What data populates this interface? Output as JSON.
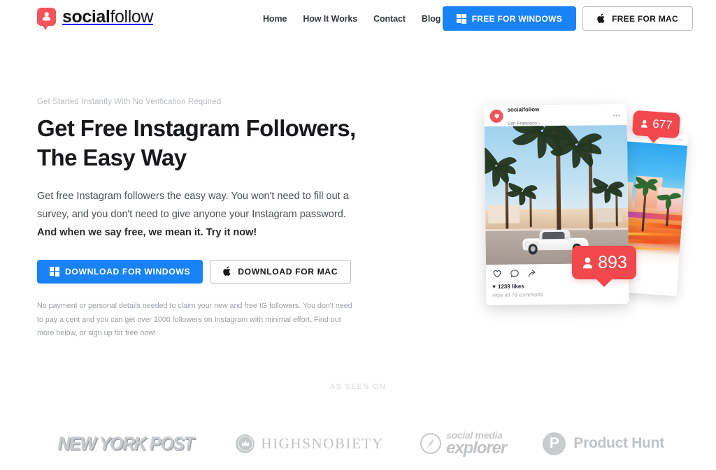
{
  "brand": {
    "name_bold": "social",
    "name_light": "follow",
    "logo_icon": "person-speech-bubble-icon",
    "accent_red": "#f2555a",
    "accent_blue": "#1a82f7"
  },
  "header": {
    "nav": [
      {
        "label": "Home"
      },
      {
        "label": "How It Works"
      },
      {
        "label": "Contact"
      },
      {
        "label": "Blog"
      }
    ],
    "buttons": [
      {
        "label": "FREE FOR WINDOWS",
        "icon": "windows-icon",
        "style": "blue"
      },
      {
        "label": "FREE FOR MAC",
        "icon": "apple-icon",
        "style": "white"
      }
    ]
  },
  "hero": {
    "eyebrow": "Get Started Instantly With No Verification Required",
    "headline_line1": "Get Free Instagram Followers,",
    "headline_line2": "The Easy Way",
    "lede_normal": "Get free Instagram followers the easy way. You won't need to fill out a survey, and you don't need to give anyone your Instagram password. ",
    "lede_bold": "And when we say free, we mean it. Try it now!",
    "cta": [
      {
        "label": "DOWNLOAD FOR WINDOWS",
        "icon": "windows-icon",
        "style": "blue"
      },
      {
        "label": "DOWNLOAD FOR MAC",
        "icon": "apple-icon",
        "style": "white"
      }
    ],
    "fineprint": "No payment or personal details needed to claim your new and free IG followers. You don't need to pay a cent and you can get over 1000 followers on Instagram with minimal effort. Find out more below, or sign up for free now!"
  },
  "instagram_mock": {
    "username": "socialfollow",
    "location": "San Francisco ›",
    "more_dots": "•••",
    "likes": "1239 likes",
    "comments": "view all 78 comments",
    "badges": [
      {
        "count": "677",
        "icon": "person-icon"
      },
      {
        "count": "893",
        "icon": "person-icon"
      }
    ],
    "actions": [
      "heart-icon",
      "comment-icon",
      "share-icon"
    ]
  },
  "press": {
    "heading": "AS SEEN ON",
    "logos": [
      {
        "name": "New York Post",
        "text": "NEW YORK POST"
      },
      {
        "name": "Highsnobiety",
        "text": "HIGHSNOBIETY",
        "icon": "crown-badge-icon"
      },
      {
        "name": "Social Media Explorer",
        "text_top": "social media",
        "text_bottom": "explorer",
        "icon": "compass-icon"
      },
      {
        "name": "Product Hunt",
        "text": "Product Hunt",
        "mark": "P"
      }
    ]
  }
}
